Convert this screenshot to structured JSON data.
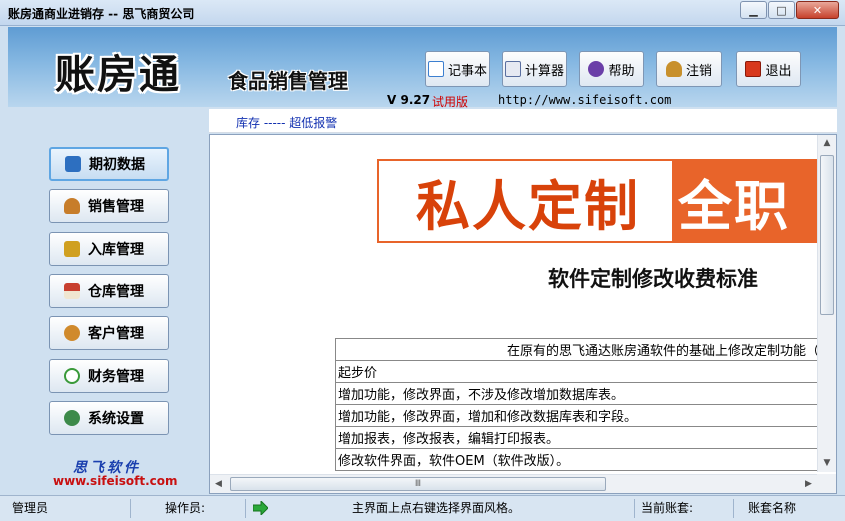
{
  "window": {
    "title": "账房通商业进销存 -- 思飞商贸公司",
    "min_label": "▁",
    "max_label": "□",
    "close_label": "✕"
  },
  "header": {
    "logo": "账房通",
    "subtitle": "食品销售管理",
    "version": "V 9.27",
    "trial": "试用版",
    "website": "http://www.sifeisoft.com"
  },
  "toolbar": [
    {
      "label": "记事本",
      "icon": "notepad-icon",
      "color": "#3c7fd0"
    },
    {
      "label": "计算器",
      "icon": "calculator-icon",
      "color": "#5a6fa0"
    },
    {
      "label": "帮助",
      "icon": "help-icon",
      "color": "#6b3fa8"
    },
    {
      "label": "注销",
      "icon": "logout-user-icon",
      "color": "#c8902c"
    },
    {
      "label": "退出",
      "icon": "exit-icon",
      "color": "#d8381c"
    }
  ],
  "info_strip": "库存 ----- 超低报警",
  "nav": [
    {
      "label": "期初数据",
      "icon": "book-icon",
      "color": "#2d6fc0",
      "active": true
    },
    {
      "label": "销售管理",
      "icon": "salesperson-icon",
      "color": "#c77d2a",
      "active": false
    },
    {
      "label": "入库管理",
      "icon": "box-icon",
      "color": "#d0a020",
      "active": false
    },
    {
      "label": "仓库管理",
      "icon": "warehouse-icon",
      "color": "#c84030",
      "active": false
    },
    {
      "label": "客户管理",
      "icon": "customers-icon",
      "color": "#d08a2c",
      "active": false
    },
    {
      "label": "财务管理",
      "icon": "finance-icon",
      "color": "#3a9a3a",
      "active": false
    },
    {
      "label": "系统设置",
      "icon": "settings-icon",
      "color": "#3d8a4a",
      "active": false
    }
  ],
  "brand": {
    "cn": "思飞软件",
    "url": "www.sifeisoft.com"
  },
  "document": {
    "banner_left": "私人定制",
    "banner_right": "全职",
    "title": "软件定制修改收费标准",
    "table_rows": [
      {
        "text": "在原有的思飞通达账房通软件的基础上修改定制功能（单",
        "head": true
      },
      {
        "text": "起步价",
        "head": false
      },
      {
        "text": "增加功能，修改界面，不涉及修改增加数据库表。",
        "head": false
      },
      {
        "text": "增加功能，修改界面，增加和修改数据库表和字段。",
        "head": false
      },
      {
        "text": "增加报表，修改报表，编辑打印报表。",
        "head": false
      },
      {
        "text": "修改软件界面，软件OEM（软件改版）。",
        "head": false
      }
    ]
  },
  "scroll": {
    "hthumb_label": "Ⅲ",
    "vthumb_label": "≡"
  },
  "status": {
    "user": "管理员",
    "operator_label": "操作员:",
    "hint": "主界面上点右键选择界面风格。",
    "account_label": "当前账套:",
    "account_name_label": "账套名称"
  }
}
